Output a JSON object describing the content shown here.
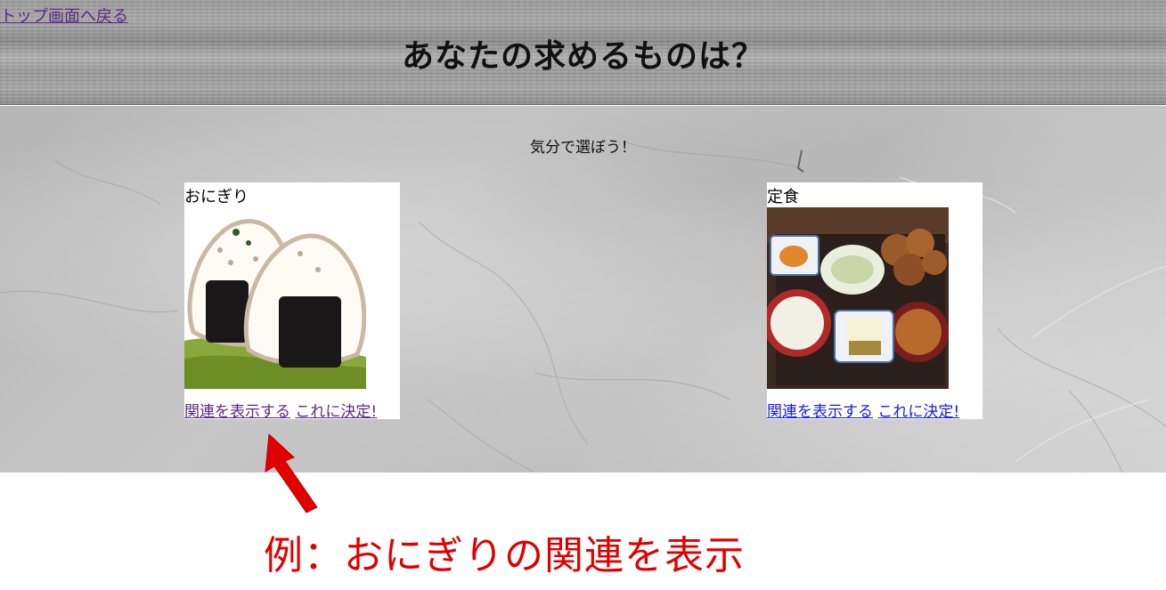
{
  "header": {
    "back_link": "トップ画面へ戻る",
    "title": "あなたの求めるものは？"
  },
  "main": {
    "subtitle": "気分で選ぼう！",
    "cards": [
      {
        "title": "おにぎり",
        "image": "onigiri-illustration",
        "show_related_label": "関連を表示する",
        "decide_label": "これに決定!"
      },
      {
        "title": "定食",
        "image": "teishoku-photo",
        "show_related_label": "関連を表示する",
        "decide_label": "これに決定!"
      }
    ]
  },
  "annotation": {
    "text": "例：おにぎりの関連を表示",
    "color": "#e00000"
  },
  "colors": {
    "visited_link": "#5a2a83",
    "link": "#1a1ae6"
  }
}
